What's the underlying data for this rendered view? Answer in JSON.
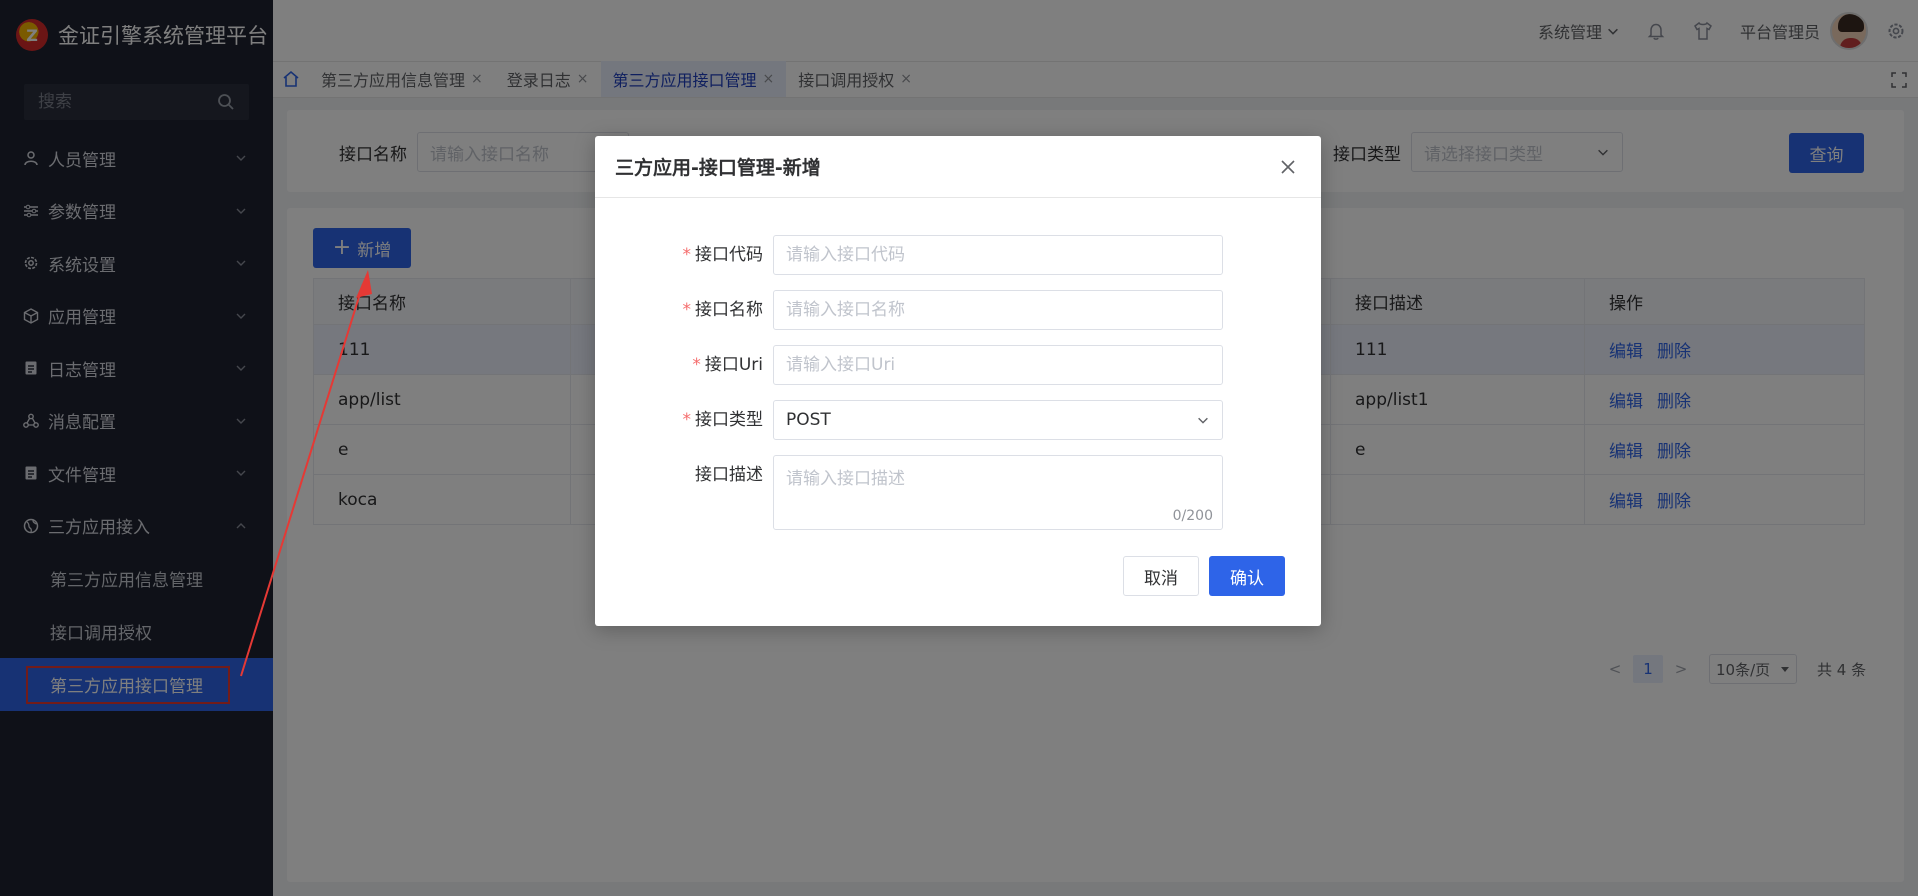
{
  "app": {
    "title": "金证引擎系统管理平台",
    "logo_glyph": "Z"
  },
  "sidebar": {
    "search_placeholder": "搜索",
    "menus": [
      {
        "label": "人员管理",
        "icon": "user-icon"
      },
      {
        "label": "参数管理",
        "icon": "sliders-icon"
      },
      {
        "label": "系统设置",
        "icon": "gear-icon"
      },
      {
        "label": "应用管理",
        "icon": "cube-icon"
      },
      {
        "label": "日志管理",
        "icon": "file-icon"
      },
      {
        "label": "消息配置",
        "icon": "share-icon"
      },
      {
        "label": "文件管理",
        "icon": "file-icon"
      },
      {
        "label": "三方应用接入",
        "icon": "globe-icon"
      }
    ],
    "sub_items": [
      "第三方应用信息管理",
      "接口调用授权",
      "第三方应用接口管理"
    ]
  },
  "header": {
    "system_menu": "系统管理",
    "user_name": "平台管理员"
  },
  "tabs": [
    {
      "label": "第三方应用信息管理",
      "close": "×"
    },
    {
      "label": "登录日志",
      "close": "×"
    },
    {
      "label": "第三方应用接口管理",
      "close": "×"
    },
    {
      "label": "接口调用授权",
      "close": "×"
    }
  ],
  "filters": {
    "name_label": "接口名称",
    "name_placeholder": "请输入接口名称",
    "type_label": "接口类型",
    "type_placeholder": "请选择接口类型",
    "query_button": "查询"
  },
  "table": {
    "add_button": "新增",
    "columns": [
      "接口名称",
      "接口描述",
      "操作"
    ],
    "rows": [
      {
        "name": "111",
        "desc": "111"
      },
      {
        "name": "app/list",
        "desc": "app/list1"
      },
      {
        "name": "e",
        "desc": "e"
      },
      {
        "name": "koca",
        "desc": ""
      }
    ],
    "edit_label": "编辑",
    "delete_label": "删除"
  },
  "pagination": {
    "prev": "<",
    "page": "1",
    "next": ">",
    "page_size": "10条/页",
    "total": "共 4 条"
  },
  "dialog": {
    "title": "三方应用-接口管理-新增",
    "code_label": "接口代码",
    "code_placeholder": "请输入接口代码",
    "name_label": "接口名称",
    "name_placeholder": "请输入接口名称",
    "uri_label": "接口Uri",
    "uri_placeholder": "请输入接口Uri",
    "type_label": "接口类型",
    "type_value": "POST",
    "desc_label": "接口描述",
    "desc_placeholder": "请输入接口描述",
    "desc_counter": "0/200",
    "required_mark": "*",
    "cancel": "取消",
    "confirm": "确认"
  },
  "colors": {
    "primary": "#2e64e8",
    "sidebar_bg": "#1f2330",
    "highlight_red": "#e53935"
  }
}
